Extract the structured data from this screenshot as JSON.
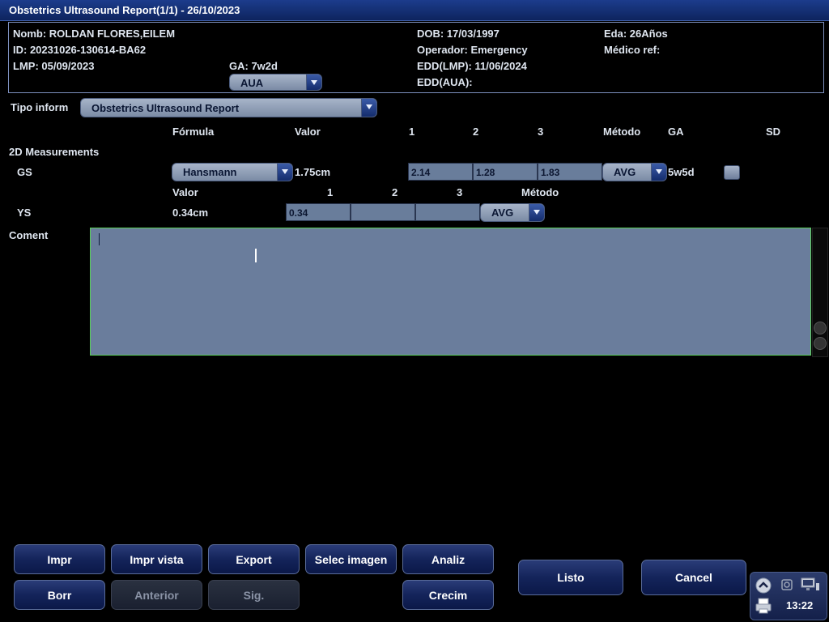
{
  "window": {
    "title": "Obstetrics Ultrasound Report(1/1) - 26/10/2023"
  },
  "patient": {
    "name": "Nomb: ROLDAN FLORES,EILEM",
    "id": "ID: 20231026-130614-BA62",
    "lmp": "LMP: 05/09/2023",
    "ga": "GA: 7w2d",
    "ga_method": "AUA",
    "dob": "DOB: 17/03/1997",
    "operator": "Operador: Emergency",
    "edd_lmp": "EDD(LMP): 11/06/2024",
    "edd_aua": "EDD(AUA):",
    "age": "Eda: 26Años",
    "ref_doctor": "Médico ref:"
  },
  "report_type": {
    "label": "Tipo inform",
    "value": "Obstetrics Ultrasound Report"
  },
  "headers": {
    "formula": "Fórmula",
    "value": "Valor",
    "m1": "1",
    "m2": "2",
    "m3": "3",
    "method": "Método",
    "ga": "GA",
    "sd": "SD"
  },
  "section_2d": "2D Measurements",
  "gs": {
    "label": "GS",
    "formula": "Hansmann",
    "value": "1.75cm",
    "m1": "2.14",
    "m2": "1.28",
    "m3": "1.83",
    "method": "AVG",
    "ga": "5w5d"
  },
  "ys_headers": {
    "value": "Valor",
    "m1": "1",
    "m2": "2",
    "m3": "3",
    "method": "Método"
  },
  "ys": {
    "label": "YS",
    "value": "0.34cm",
    "m1": "0.34",
    "m2": "",
    "m3": "",
    "method": "AVG"
  },
  "comment": {
    "label": "Coment",
    "text": ""
  },
  "buttons": {
    "print": "Impr",
    "print_view": "Impr vista",
    "export": "Export",
    "select_image": "Selec imagen",
    "analyze": "Analiz",
    "delete": "Borr",
    "previous": "Anterior",
    "next": "Sig.",
    "growth": "Crecim",
    "done": "Listo",
    "cancel": "Cancel"
  },
  "tray": {
    "time": "13:22"
  },
  "colors": {
    "title_bar": "#0e245e",
    "field": "#697d9b",
    "comment_border": "#5ad05a"
  }
}
